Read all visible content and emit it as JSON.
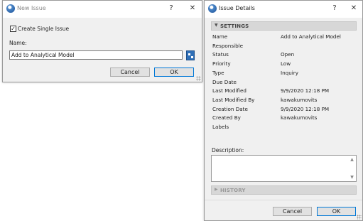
{
  "new_issue": {
    "title": "New Issue",
    "help": "?",
    "close": "✕",
    "create_single_label": "Create Single Issue",
    "create_single_checked": true,
    "name_label": "Name:",
    "name_value": "Add to Analytical Model",
    "cancel": "Cancel",
    "ok": "OK"
  },
  "issue_details": {
    "title": "Issue Details",
    "help": "?",
    "close": "✕",
    "settings_header": "SETTINGS",
    "fields": [
      {
        "label": "Name",
        "value": "Add to Analytical Model"
      },
      {
        "label": "Responsible",
        "value": ""
      },
      {
        "label": "Status",
        "value": "Open"
      },
      {
        "label": "Priority",
        "value": "Low"
      },
      {
        "label": "Type",
        "value": "Inquiry"
      },
      {
        "label": "Due Date",
        "value": ""
      },
      {
        "label": "Last Modified",
        "value": "9/9/2020 12:18 PM"
      },
      {
        "label": "Last Modified By",
        "value": "kawakumovits"
      },
      {
        "label": "Creation Date",
        "value": "9/9/2020 12:18 PM"
      },
      {
        "label": "Created By",
        "value": "kawakumovits"
      },
      {
        "label": "Labels",
        "value": ""
      }
    ],
    "description_label": "Description:",
    "description_value": "",
    "history_header": "HISTORY",
    "cancel": "Cancel",
    "ok": "OK"
  },
  "colors": {
    "dialog_bg": "#f0f0f0",
    "accent": "#0078d7",
    "pick_button": "#2f6fb7"
  }
}
